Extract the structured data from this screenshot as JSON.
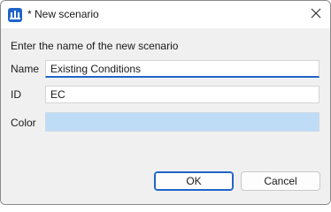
{
  "window": {
    "title": "* New scenario",
    "app_icon": "app-logo-icon",
    "close_icon": "close-icon"
  },
  "form": {
    "prompt": "Enter the name of the new scenario",
    "name_label": "Name",
    "name_value": "Existing Conditions",
    "id_label": "ID",
    "id_value": "EC",
    "color_label": "Color",
    "color_value": "#bfdcf7"
  },
  "buttons": {
    "ok_label": "OK",
    "cancel_label": "Cancel"
  },
  "colors": {
    "accent": "#1f64c8",
    "dialog_bg": "#f0f0f0"
  }
}
